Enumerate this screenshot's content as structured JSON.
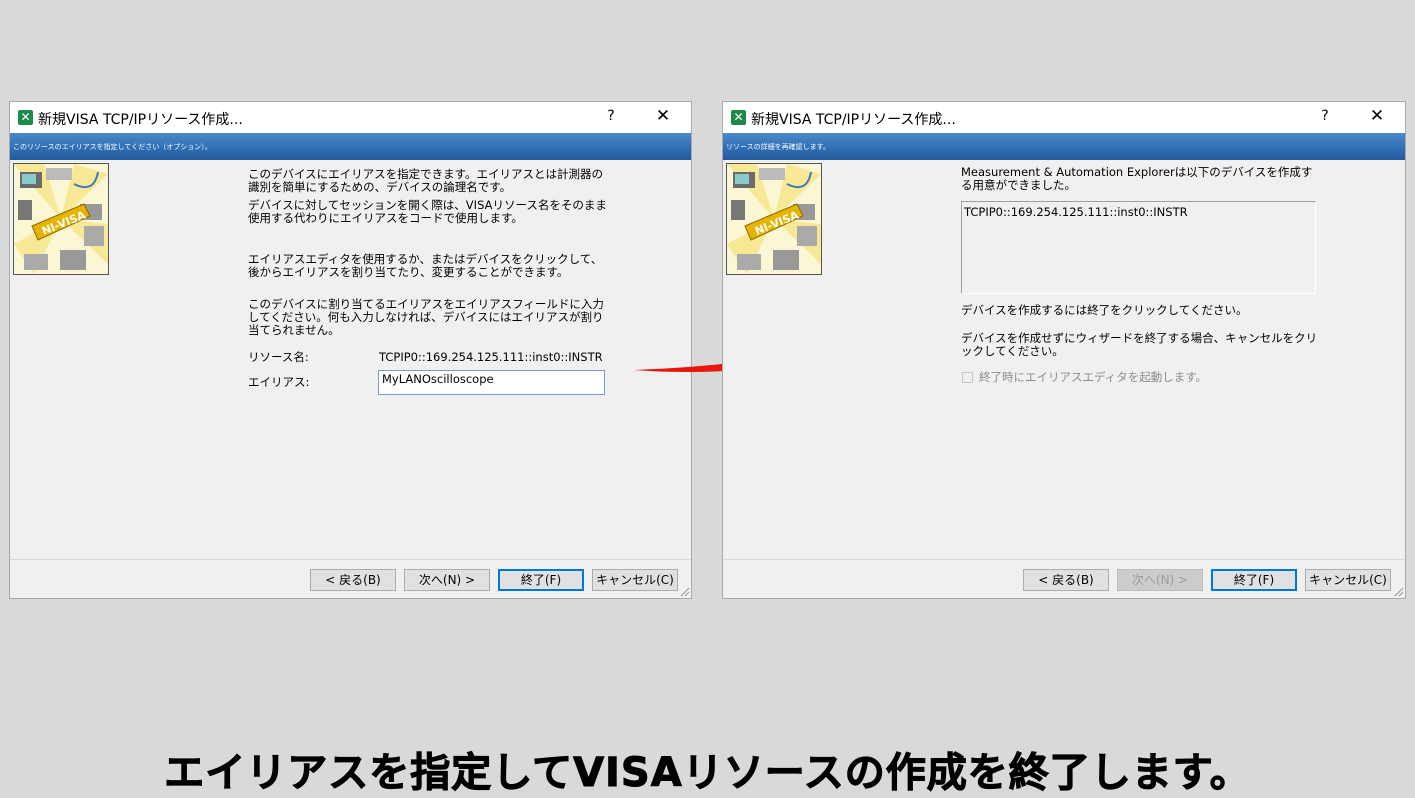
{
  "left_dialog": {
    "title": "新規VISA TCP/IPリソース作成...",
    "help": "?",
    "close": "✕",
    "banner": "このリソースのエイリアスを指定してください（オプション）。",
    "para1": "このデバイスにエイリアスを指定できます。エイリアスとは計測器の識別を簡単にするための、デバイスの論理名です。",
    "para2": "デバイスに対してセッションを開く際は、VISAリソース名をそのまま使用する代わりにエイリアスをコードで使用します。",
    "para3": "エイリアスエディタを使用するか、またはデバイスをクリックして、後からエイリアスを割り当てたり、変更することができます。",
    "para4": "このデバイスに割り当てるエイリアスをエイリアスフィールドに入力してください。何も入力しなければ、デバイスにはエイリアスが割り当てられません。",
    "resource_label": "リソース名:",
    "resource_value": "TCPIP0::169.254.125.111::inst0::INSTR",
    "alias_label": "エイリアス:",
    "alias_value": "MyLANOscilloscope",
    "buttons": {
      "back": "< 戻る(B)",
      "next": "次へ(N) >",
      "finish": "終了(F)",
      "cancel": "キャンセル(C)"
    }
  },
  "right_dialog": {
    "title": "新規VISA TCP/IPリソース作成...",
    "help": "?",
    "close": "✕",
    "banner": "リソースの詳細を再確認します。",
    "para1": "Measurement & Automation Explorerは以下のデバイスを作成する用意ができました。",
    "summary": "TCPIP0::169.254.125.111::inst0::INSTR",
    "para2": "デバイスを作成するには終了をクリックしてください。",
    "para3": "デバイスを作成せずにウィザードを終了する場合、キャンセルをクリックしてください。",
    "checkbox_label": "終了時にエイリアスエディタを起動します。",
    "buttons": {
      "back": "< 戻る(B)",
      "next": "次へ(N) >",
      "finish": "終了(F)",
      "cancel": "キャンセル(C)"
    }
  },
  "hero_text": "NI-VISA",
  "caption": "エイリアスを指定してVISAリソースの作成を終了します。",
  "colors": {
    "banner": "#2d6db3",
    "arrow": "#e8160c",
    "app_icon": "#1e8a4a"
  }
}
